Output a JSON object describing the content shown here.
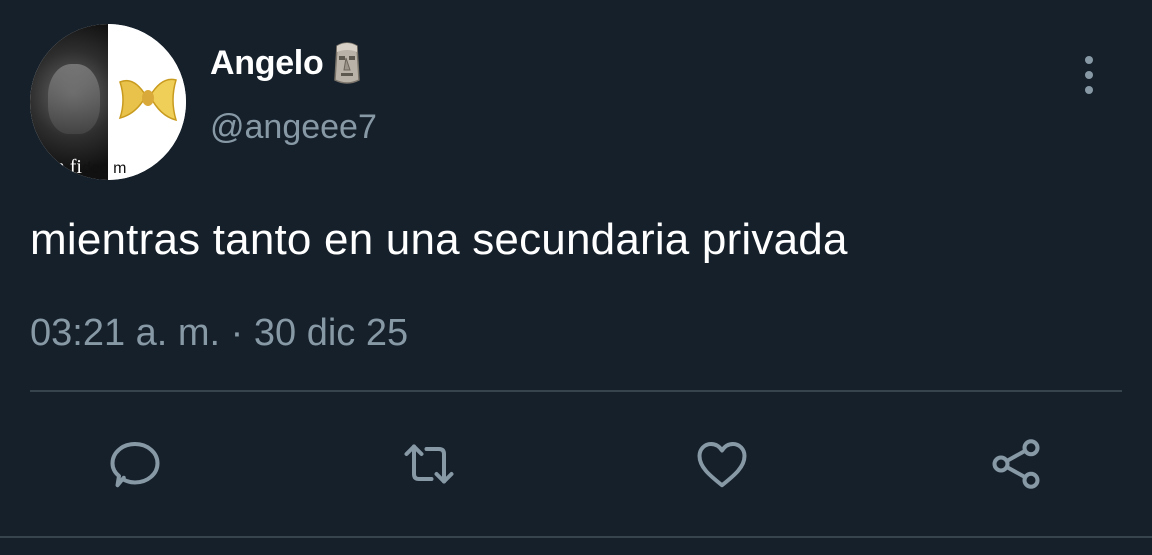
{
  "tweet": {
    "author": {
      "display_name": "Angelo",
      "name_emoji": "moai-icon",
      "handle": "@angeee7",
      "avatar_caption": "i'm fi",
      "avatar_caption_right": "deo m"
    },
    "text": "mientras tanto en una secundaria privada",
    "timestamp": "03:21 a. m. · 30 dic 25",
    "actions": [
      {
        "icon": "reply-icon"
      },
      {
        "icon": "retweet-icon"
      },
      {
        "icon": "like-icon"
      },
      {
        "icon": "share-icon"
      }
    ],
    "menu_icon": "more-options-icon"
  },
  "colors": {
    "background": "#15202b",
    "primary_text": "#ffffff",
    "secondary_text": "#8899a6",
    "divider": "#38444d"
  }
}
